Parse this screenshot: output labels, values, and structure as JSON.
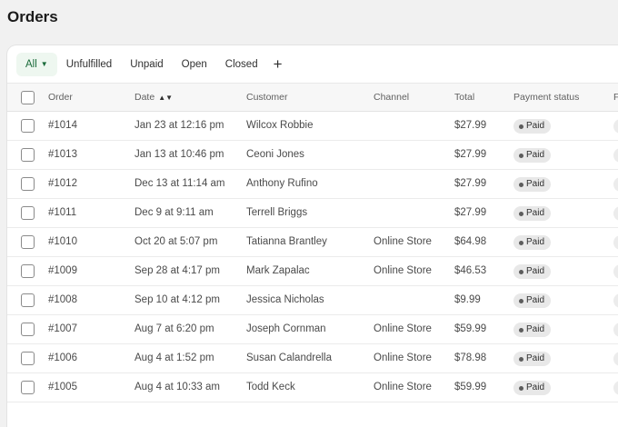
{
  "page": {
    "title": "Orders"
  },
  "tabs": [
    {
      "label": "All",
      "active": true
    },
    {
      "label": "Unfulfilled"
    },
    {
      "label": "Unpaid"
    },
    {
      "label": "Open"
    },
    {
      "label": "Closed"
    }
  ],
  "add_tab_icon": "plus-icon",
  "columns": {
    "order": "Order",
    "date": "Date",
    "customer": "Customer",
    "channel": "Channel",
    "total": "Total",
    "payment_status": "Payment status",
    "fulfillment_truncated": "F"
  },
  "rows": [
    {
      "order": "#1014",
      "date": "Jan 23 at 12:16 pm",
      "customer": "Wilcox Robbie",
      "channel": "",
      "total": "$27.99",
      "payment_status": "Paid"
    },
    {
      "order": "#1013",
      "date": "Jan 13 at 10:46 pm",
      "customer": "Ceoni Jones",
      "channel": "",
      "total": "$27.99",
      "payment_status": "Paid"
    },
    {
      "order": "#1012",
      "date": "Dec 13 at 11:14 am",
      "customer": "Anthony Rufino",
      "channel": "",
      "total": "$27.99",
      "payment_status": "Paid"
    },
    {
      "order": "#1011",
      "date": "Dec 9 at 9:11 am",
      "customer": "Terrell Briggs",
      "channel": "",
      "total": "$27.99",
      "payment_status": "Paid"
    },
    {
      "order": "#1010",
      "date": "Oct 20 at 5:07 pm",
      "customer": "Tatianna Brantley",
      "channel": "Online Store",
      "total": "$64.98",
      "payment_status": "Paid"
    },
    {
      "order": "#1009",
      "date": "Sep 28 at 4:17 pm",
      "customer": "Mark Zapalac",
      "channel": "Online Store",
      "total": "$46.53",
      "payment_status": "Paid"
    },
    {
      "order": "#1008",
      "date": "Sep 10 at 4:12 pm",
      "customer": "Jessica Nicholas",
      "channel": "",
      "total": "$9.99",
      "payment_status": "Paid"
    },
    {
      "order": "#1007",
      "date": "Aug 7 at 6:20 pm",
      "customer": "Joseph Cornman",
      "channel": "Online Store",
      "total": "$59.99",
      "payment_status": "Paid"
    },
    {
      "order": "#1006",
      "date": "Aug 4 at 1:52 pm",
      "customer": "Susan Calandrella",
      "channel": "Online Store",
      "total": "$78.98",
      "payment_status": "Paid"
    },
    {
      "order": "#1005",
      "date": "Aug 4 at 10:33 am",
      "customer": "Todd Keck",
      "channel": "Online Store",
      "total": "$59.99",
      "payment_status": "Paid"
    }
  ]
}
